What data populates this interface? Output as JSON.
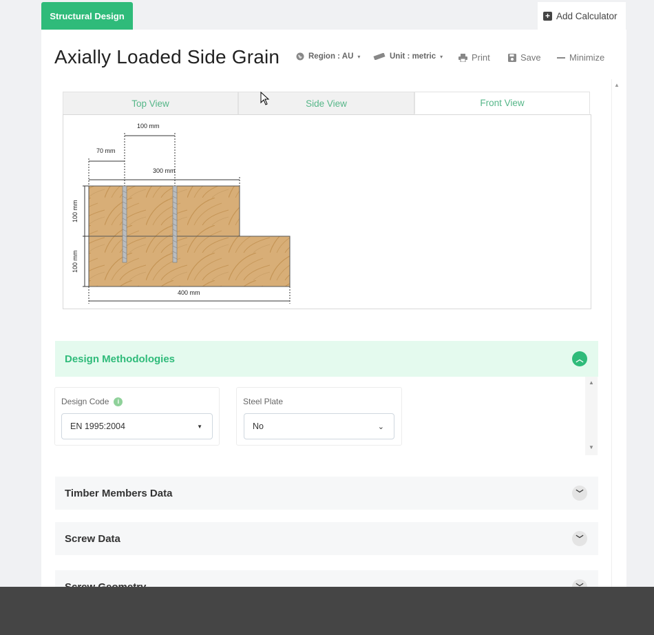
{
  "tabs": {
    "active_label": "Structural Design",
    "add_label": "Add Calculator"
  },
  "header": {
    "title": "Axially Loaded Side Grain",
    "region_label": "Region : AU",
    "unit_label": "Unit : metric",
    "print_label": "Print",
    "save_label": "Save",
    "minimize_label": "Minimize"
  },
  "view_tabs": [
    {
      "label": "Top View",
      "active": false
    },
    {
      "label": "Side View",
      "active": false
    },
    {
      "label": "Front View",
      "active": true
    }
  ],
  "diagram": {
    "dim_100_top": "100 mm",
    "dim_70": "70 mm",
    "dim_300": "300 mm",
    "dim_100_left_upper": "100 mm",
    "dim_100_left_lower": "100 mm",
    "dim_400": "400 mm"
  },
  "sections": {
    "design_methodologies": "Design Methodologies",
    "timber_members": "Timber Members Data",
    "screw_data": "Screw Data",
    "screw_geometry": "Screw Geometry"
  },
  "fields": {
    "design_code": {
      "label": "Design Code",
      "value": "EN 1995:2004"
    },
    "steel_plate": {
      "label": "Steel Plate",
      "value": "No"
    }
  },
  "colors": {
    "accent": "#2fbb7a",
    "open_section_bg": "#e4faee",
    "wood": "#d9b07a"
  }
}
